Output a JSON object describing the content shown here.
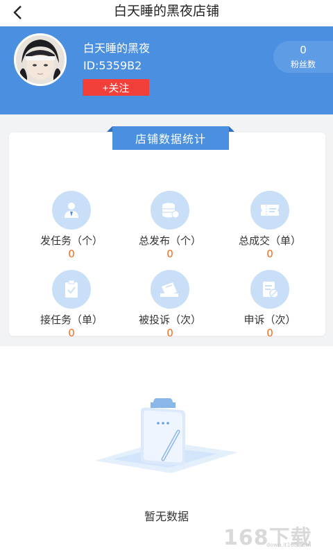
{
  "nav": {
    "title": "白天睡的黑夜店铺"
  },
  "profile": {
    "name": "白天睡的黑夜",
    "id_text": "ID:5359B2",
    "follow_label": "+关注",
    "fans_count": "0",
    "fans_label": "粉丝数"
  },
  "stats": {
    "title": "店铺数据统计",
    "items": [
      {
        "label": "发任务（个）",
        "value": "0",
        "icon": "user-badge-icon"
      },
      {
        "label": "总发布（个）",
        "value": "0",
        "icon": "coins-icon"
      },
      {
        "label": "总成交（单）",
        "value": "0",
        "icon": "ticket-icon"
      },
      {
        "label": "接任务（单）",
        "value": "0",
        "icon": "clipboard-check-icon"
      },
      {
        "label": "被投诉（次）",
        "value": "0",
        "icon": "complaint-icon"
      },
      {
        "label": "申诉（次）",
        "value": "0",
        "icon": "appeal-document-icon"
      }
    ]
  },
  "empty": {
    "text": "暂无数据"
  },
  "watermark": {
    "main": "168下载",
    "sub": "down.it168.com"
  },
  "colors": {
    "primary_blue": "#4a8fe0",
    "follow_red": "#f23f3a",
    "value_orange": "#f26b1d",
    "icon_bg": "#c9dff7"
  }
}
